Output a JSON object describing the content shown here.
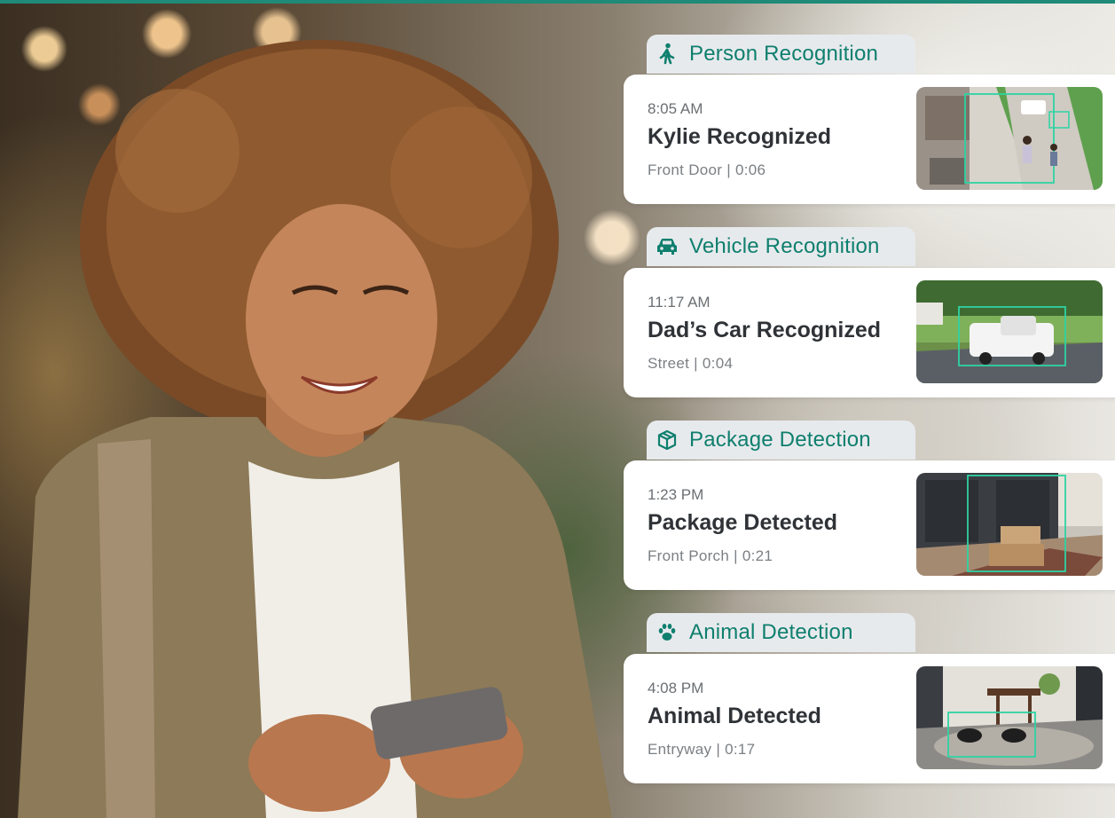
{
  "colors": {
    "accent": "#0f7f6e",
    "box": "#2ed3a3",
    "tab_bg": "#e7eaed"
  },
  "cards": [
    {
      "category": "Person Recognition",
      "icon": "walking-person-icon",
      "time": "8:05 AM",
      "title": "Kylie Recognized",
      "meta": "Front Door | 0:06"
    },
    {
      "category": "Vehicle Recognition",
      "icon": "car-icon",
      "time": "11:17 AM",
      "title": "Dad’s Car Recognized",
      "meta": "Street | 0:04"
    },
    {
      "category": "Package Detection",
      "icon": "package-icon",
      "time": "1:23 PM",
      "title": "Package Detected",
      "meta": "Front Porch | 0:21"
    },
    {
      "category": "Animal Detection",
      "icon": "paw-icon",
      "time": "4:08 PM",
      "title": "Animal Detected",
      "meta": "Entryway | 0:17"
    }
  ]
}
